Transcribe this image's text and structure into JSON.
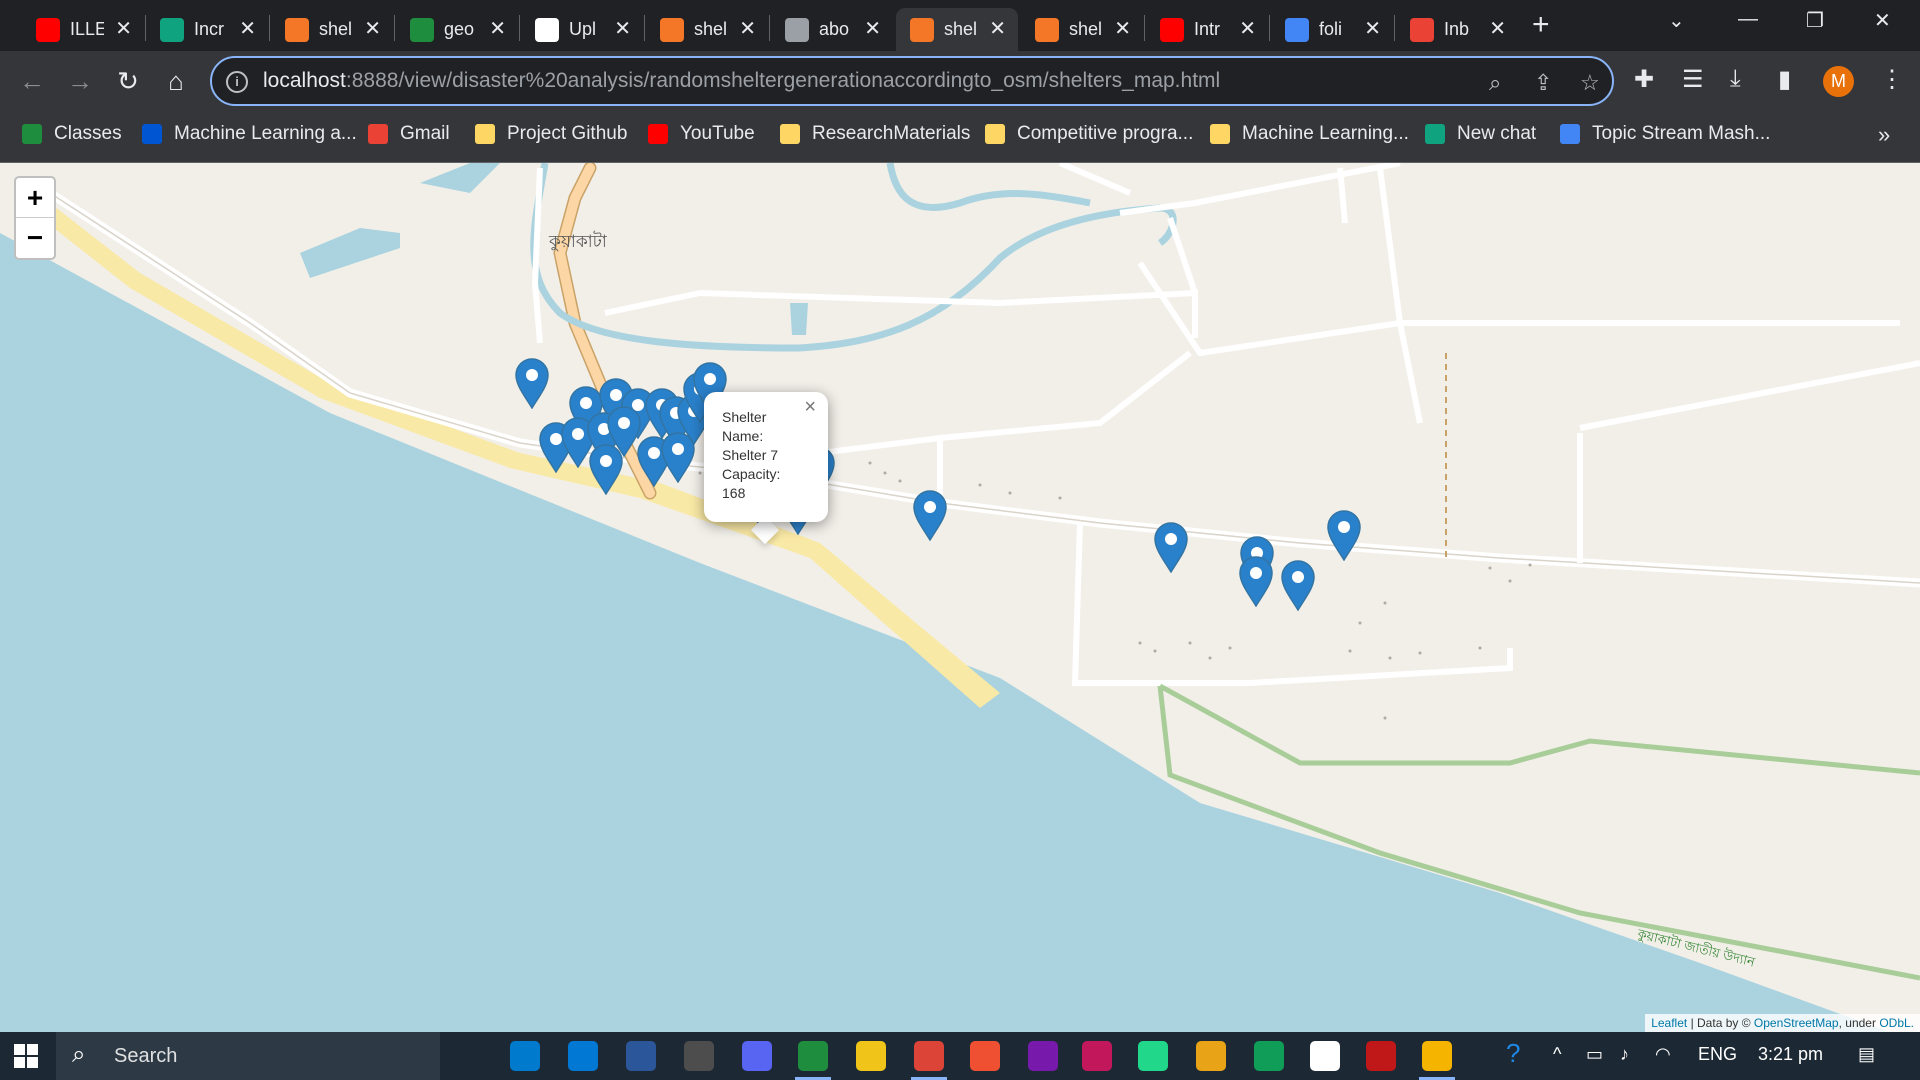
{
  "browser": {
    "tabs": [
      {
        "label": "ILLE",
        "icon": "youtube-icon",
        "color": "#ff0000"
      },
      {
        "label": "Incr",
        "icon": "chatgpt-icon",
        "color": "#10a37f"
      },
      {
        "label": "shel",
        "icon": "jupyter-notebook-icon",
        "color": "#f37726"
      },
      {
        "label": "geo",
        "icon": "geo-site-icon",
        "color": "#1e8e3e"
      },
      {
        "label": "Upl",
        "icon": "github-icon",
        "color": "#ffffff"
      },
      {
        "label": "shel",
        "icon": "jupyter-notebook-icon",
        "color": "#f37726"
      },
      {
        "label": "abo",
        "icon": "globe-icon",
        "color": "#9aa0a6"
      },
      {
        "label": "shel",
        "icon": "loading-spinner-icon",
        "color": "#f37726",
        "active": true
      },
      {
        "label": "shel",
        "icon": "jupyter-notebook-icon",
        "color": "#f37726"
      },
      {
        "label": "Intr",
        "icon": "youtube-icon",
        "color": "#ff0000"
      },
      {
        "label": "foli",
        "icon": "google-icon",
        "color": "#4285f4"
      },
      {
        "label": "Inb",
        "icon": "gmail-icon",
        "color": "#ea4335"
      }
    ],
    "close_glyph": "✕",
    "new_tab_glyph": "+",
    "url_host": "localhost",
    "url_rest": ":8888/view/disaster%20analysis/randomsheltergenerationaccordingto_osm/shelters_map.html",
    "profile_initial": "M",
    "profile_color": "#e8710a"
  },
  "bookmarks": [
    {
      "label": "Classes",
      "icon": "google-classroom-icon",
      "color": "#1e8e3e"
    },
    {
      "label": "Machine Learning a...",
      "icon": "coursera-icon",
      "color": "#0056d2"
    },
    {
      "label": "Gmail",
      "icon": "gmail-icon",
      "color": "#ea4335"
    },
    {
      "label": "Project Github",
      "icon": "folder-icon",
      "color": "#fdd663"
    },
    {
      "label": "YouTube",
      "icon": "youtube-icon",
      "color": "#ff0000"
    },
    {
      "label": "ResearchMaterials",
      "icon": "folder-icon",
      "color": "#fdd663"
    },
    {
      "label": "Competitive progra...",
      "icon": "folder-icon",
      "color": "#fdd663"
    },
    {
      "label": "Machine Learning...",
      "icon": "folder-icon",
      "color": "#fdd663"
    },
    {
      "label": "New chat",
      "icon": "chatgpt-icon",
      "color": "#10a37f"
    },
    {
      "label": "Topic Stream Mash...",
      "icon": "chart-bars-icon",
      "color": "#4285f4"
    }
  ],
  "bookmarks_more": "»",
  "map": {
    "zoom_in": "+",
    "zoom_out": "−",
    "place_label": "কুয়াকাটা",
    "park_label": "কুয়াকাটা জাতীয় উদ্যান",
    "popup": {
      "line1": "Shelter",
      "line2": "Name:",
      "line3": "Shelter 7",
      "line4": "Capacity:",
      "line5": "168",
      "close": "×"
    },
    "marker_color": "#2a81cb",
    "attribution": {
      "leaflet": "Leaflet",
      "text": "| Data by ©",
      "osm": "OpenStreetMap",
      "under": ", under",
      "odbl": "ODbL."
    }
  },
  "taskbar": {
    "search_placeholder": "Search",
    "apps": [
      {
        "icon": "task-view-icon",
        "color": "#1c2833"
      },
      {
        "icon": "vscode-icon",
        "color": "#007acc"
      },
      {
        "icon": "mail-icon",
        "color": "#0078d4"
      },
      {
        "icon": "word-icon",
        "color": "#2b579a"
      },
      {
        "icon": "terminal-icon",
        "color": "#4d4d4d"
      },
      {
        "icon": "discord-icon",
        "color": "#5865f2"
      },
      {
        "icon": "chrome-icon",
        "color": "#1e8e3e"
      },
      {
        "icon": "file-explorer-icon",
        "color": "#f0c419"
      },
      {
        "icon": "chrome-icon",
        "color": "#db4437"
      },
      {
        "icon": "git-icon",
        "color": "#f05032"
      },
      {
        "icon": "onenote-icon",
        "color": "#7719aa"
      },
      {
        "icon": "screen-record-icon",
        "color": "#c2185b"
      },
      {
        "icon": "pycharm-icon",
        "color": "#21d789"
      },
      {
        "icon": "layers-app-icon",
        "color": "#e8a317"
      },
      {
        "icon": "chrome-icon",
        "color": "#0f9d58"
      },
      {
        "icon": "notion-icon",
        "color": "#ffffff"
      },
      {
        "icon": "mcafee-icon",
        "color": "#c01818"
      },
      {
        "icon": "photo-app-icon",
        "color": "#f4b400"
      }
    ],
    "tray_language": "ENG",
    "tray_time": "3:21 pm"
  }
}
